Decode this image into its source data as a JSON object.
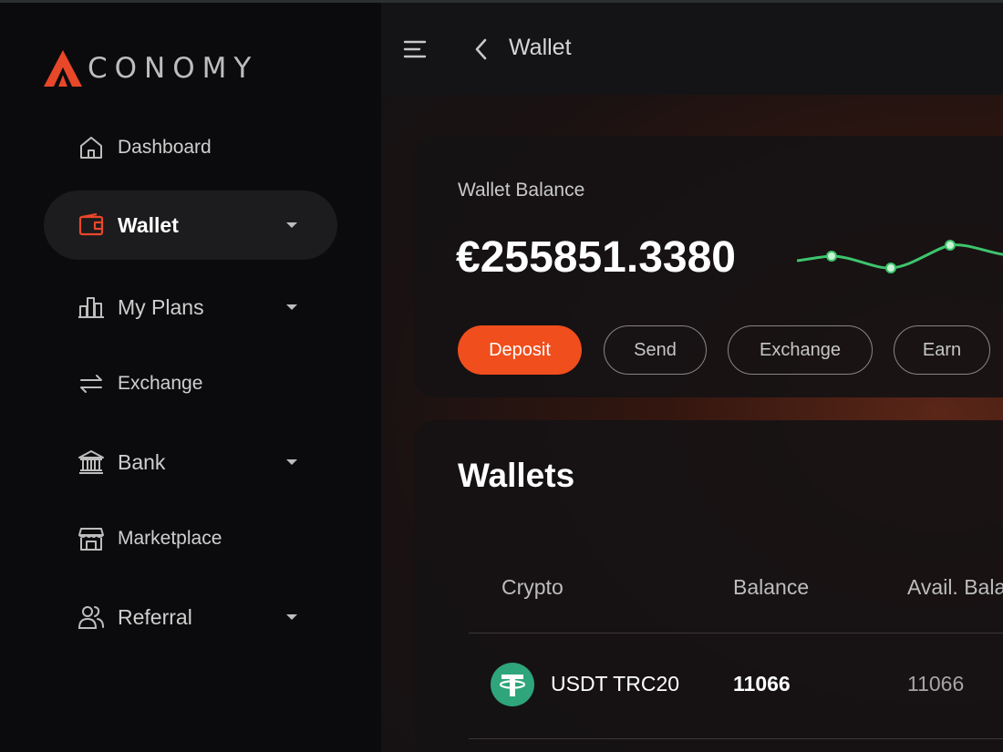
{
  "brand": {
    "name": "ACONOMY",
    "logo_text": "CONOMY",
    "accent": "#e8472a"
  },
  "sidebar": {
    "items": [
      {
        "label": "Dashboard",
        "icon": "home-icon",
        "expandable": false,
        "active": false
      },
      {
        "label": "Wallet",
        "icon": "wallet-icon",
        "expandable": true,
        "active": true
      },
      {
        "label": "My Plans",
        "icon": "bar-chart-icon",
        "expandable": true,
        "active": false
      },
      {
        "label": "Exchange",
        "icon": "swap-arrows-icon",
        "expandable": false,
        "active": false
      },
      {
        "label": "Bank",
        "icon": "bank-icon",
        "expandable": true,
        "active": false
      },
      {
        "label": "Marketplace",
        "icon": "store-icon",
        "expandable": false,
        "active": false
      },
      {
        "label": "Referral",
        "icon": "users-icon",
        "expandable": true,
        "active": false
      }
    ]
  },
  "header": {
    "title": "Wallet",
    "menu_icon": "menu-icon",
    "back_icon": "chevron-left-icon"
  },
  "balance": {
    "label": "Wallet Balance",
    "value": "€255851.3380",
    "sparkline_color": "#3ec46d",
    "actions": {
      "deposit": "Deposit",
      "send": "Send",
      "exchange": "Exchange",
      "earn": "Earn"
    },
    "primary_color": "#f04e1c"
  },
  "wallets": {
    "title": "Wallets",
    "columns": {
      "crypto": "Crypto",
      "balance": "Balance",
      "avail": "Avail. Bala"
    },
    "rows": [
      {
        "crypto": "USDT TRC20",
        "balance": "11066",
        "avail": "11066",
        "icon": "tether-icon",
        "icon_color": "#2ea57a"
      }
    ]
  }
}
